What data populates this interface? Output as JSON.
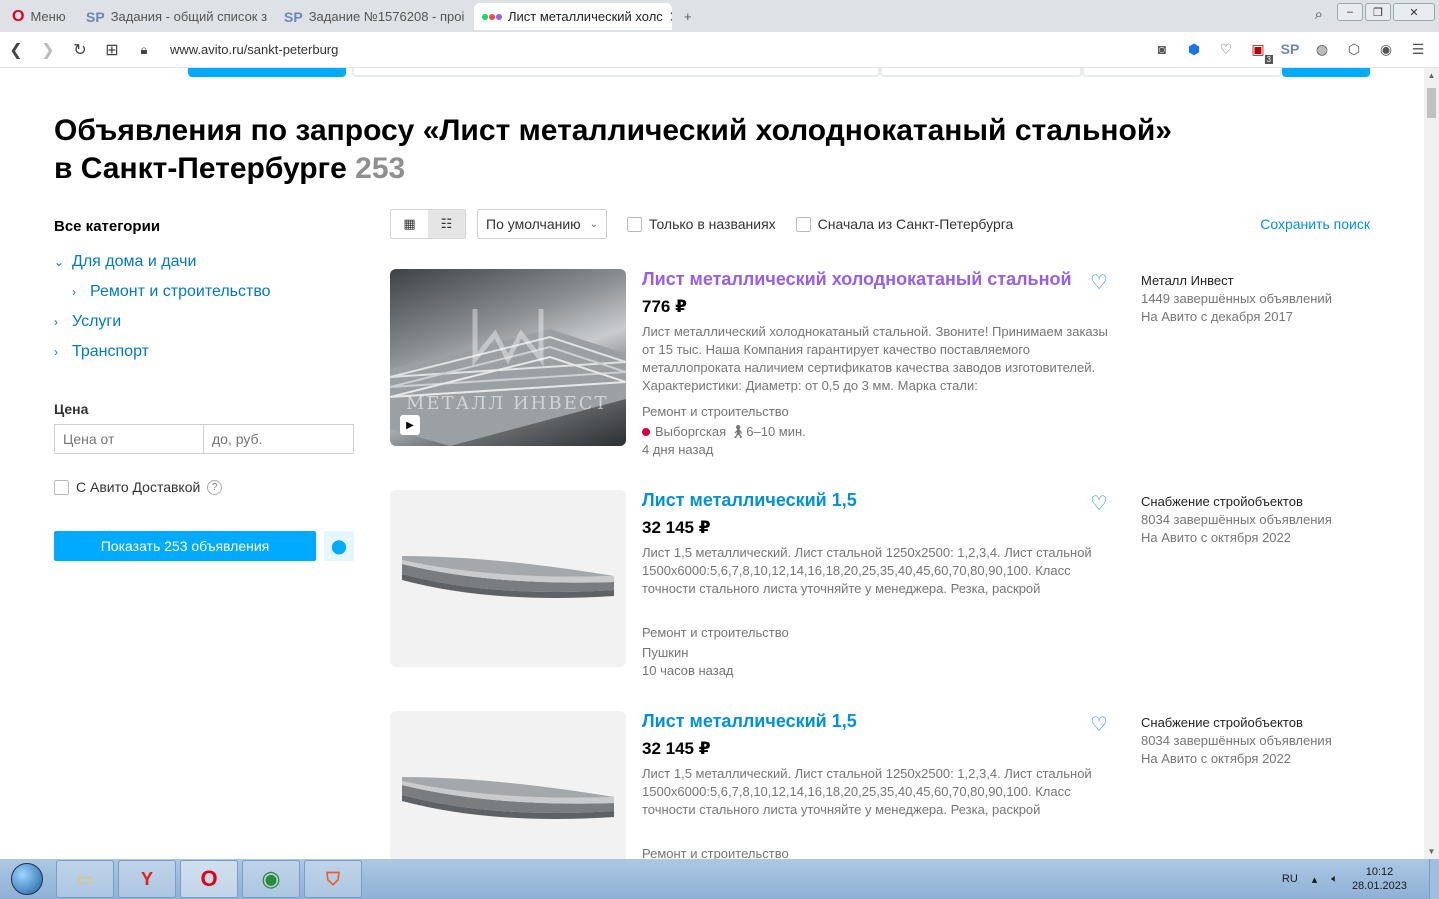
{
  "browser": {
    "menu_label": "Меню",
    "tabs": [
      {
        "label": "Задания - общий список з",
        "badge": "SP"
      },
      {
        "label": "Задание №1576208 - проі",
        "badge": "SP"
      },
      {
        "label": "Лист металлический холс",
        "badge": ""
      }
    ],
    "url": "www.avito.ru/sankt-peterburg",
    "counter_badge": "3"
  },
  "page": {
    "heading_line1": "Объявления по запросу «Лист металлический холоднокатаный стальной»",
    "heading_line2": "в Санкт-Петербурге",
    "result_count": "253"
  },
  "sidebar": {
    "categories_title": "Все категории",
    "categories": [
      {
        "label": "Для дома и дачи"
      },
      {
        "label": "Ремонт и строительство"
      },
      {
        "label": "Услуги"
      },
      {
        "label": "Транспорт"
      }
    ],
    "price_label": "Цена",
    "price_from_placeholder": "Цена от",
    "price_to_placeholder": "до, руб.",
    "delivery_label": "С Авито Доставкой",
    "show_button": "Показать 253 объявления"
  },
  "toolbar": {
    "sort_value": "По умолчанию",
    "only_titles": "Только в названиях",
    "spb_first": "Сначала из Санкт-Петербурга",
    "save_search": "Сохранить поиск"
  },
  "listings": [
    {
      "title": "Лист металлический холоднокатаный стальной",
      "price": "776 ₽",
      "description": "Лист металлический холоднокатаный стальной. Звоните! Принимаем заказы от 15 тыс. Наша Компания гарантирует качество поставляемого металлопроката наличием сертификатов качества заводов изготовителей. Характеристики: Диаметр: от 0,5 до 3 мм. Марка стали:",
      "category": "Ремонт и строительство",
      "location": "Выборгская",
      "walk": "6–10 мин.",
      "date": "4 дня назад",
      "seller": "Металл Инвест",
      "seller_ads": "1449 завершённых объявлений",
      "seller_since": "На Авито с декабря 2017",
      "watermark": "МЕТАЛЛ ИНВЕСТ"
    },
    {
      "title": "Лист металлический 1,5",
      "price": "32 145 ₽",
      "description": "Лист 1,5 металлический. Лист стальной 1250x2500: 1,2,3,4. Лист стальной 1500x6000:5,6,7,8,10,12,14,16,18,20,25,35,40,45,60,70,80,90,100. Класс точности стального листа уточняйте у менеджера. Резка, раскрой",
      "category": "Ремонт и строительство",
      "location": "Пушкин",
      "date": "10 часов назад",
      "seller": "Снабжение стройобъектов",
      "seller_ads": "8034 завершённых объявления",
      "seller_since": "На Авито с октября 2022"
    },
    {
      "title": "Лист металлический 1,5",
      "price": "32 145 ₽",
      "description": "Лист 1,5 металлический. Лист стальной 1250x2500: 1,2,3,4. Лист стальной 1500x6000:5,6,7,8,10,12,14,16,18,20,25,35,40,45,60,70,80,90,100. Класс точности стального листа уточняйте у менеджера. Резка, раскрой",
      "category": "Ремонт и строительство",
      "seller": "Снабжение стройобъектов",
      "seller_ads": "8034 завершённых объявления",
      "seller_since": "На Авито с октября 2022"
    }
  ],
  "taskbar": {
    "lang": "RU",
    "time": "10:12",
    "date": "28.01.2023"
  },
  "colors": {
    "link": "#0091d9",
    "visited": "#965eeb",
    "primary_button": "#00aaff",
    "metro": "#d4003b"
  }
}
